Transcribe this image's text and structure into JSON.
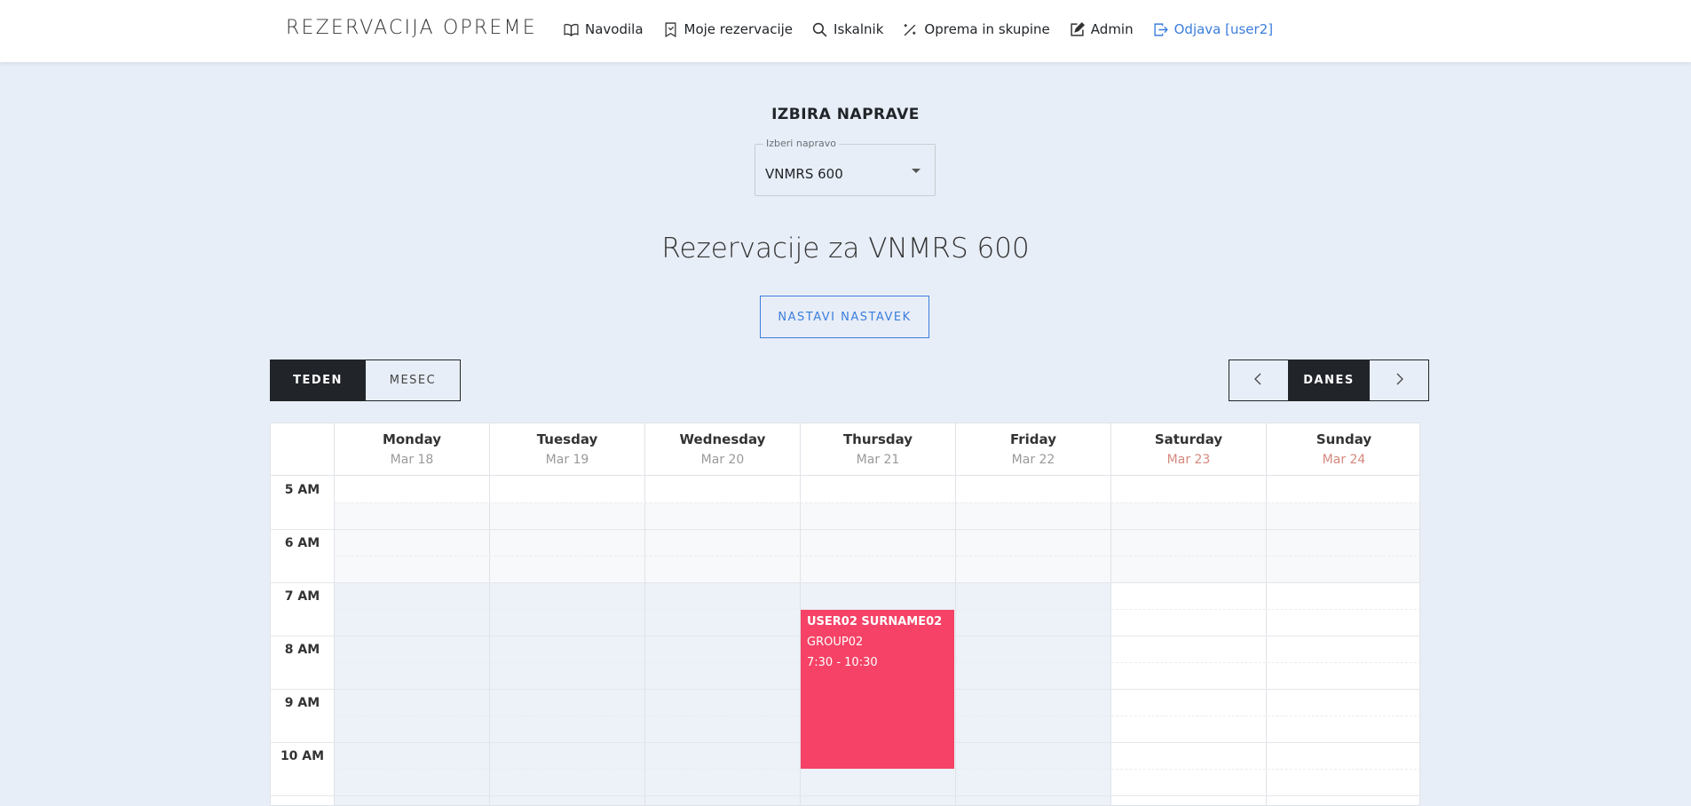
{
  "navbar": {
    "brand": "REZERVACIJA OPREME",
    "items": [
      {
        "label": "Navodila",
        "icon": "book-icon"
      },
      {
        "label": "Moje rezervacije",
        "icon": "bookmark-icon"
      },
      {
        "label": "Iskalnik",
        "icon": "search-icon"
      },
      {
        "label": "Oprema in skupine",
        "icon": "magic-wand-icon"
      },
      {
        "label": "Admin",
        "icon": "edit-icon"
      },
      {
        "label": "Odjava [user2]",
        "icon": "logout-icon"
      }
    ]
  },
  "device_section": {
    "title": "IZBIRA NAPRAVE",
    "select_legend": "Izberi napravo",
    "select_value": "VNMRS 600"
  },
  "heading": "Rezervacije za VNMRS 600",
  "set_extension_label": "NASTAVI NASTAVEK",
  "view_toggle": {
    "week": "TEDEN",
    "month": "MESEC",
    "active": "week"
  },
  "nav": {
    "today": "DANES",
    "prev_icon": "chevron-left-icon",
    "next_icon": "chevron-right-icon"
  },
  "calendar": {
    "days": [
      {
        "name": "Monday",
        "date": "Mar 18",
        "weekend": false
      },
      {
        "name": "Tuesday",
        "date": "Mar 19",
        "weekend": false
      },
      {
        "name": "Wednesday",
        "date": "Mar 20",
        "weekend": false
      },
      {
        "name": "Thursday",
        "date": "Mar 21",
        "weekend": false
      },
      {
        "name": "Friday",
        "date": "Mar 22",
        "weekend": false
      },
      {
        "name": "Saturday",
        "date": "Mar 23",
        "weekend": true
      },
      {
        "name": "Sunday",
        "date": "Mar 24",
        "weekend": true
      }
    ],
    "hours": [
      "5 AM",
      "6 AM",
      "7 AM",
      "8 AM",
      "9 AM",
      "10 AM"
    ],
    "events": [
      {
        "day": "Thursday",
        "user": "USER02 SURNAME02",
        "group": "GROUP02",
        "time": "7:30 - 10:30"
      }
    ],
    "colors": {
      "event": "#f54266",
      "weekday_business_hours": "#edf1f8",
      "off_hours": "#f8f9fa",
      "weekend_date": "#d4887d"
    }
  }
}
